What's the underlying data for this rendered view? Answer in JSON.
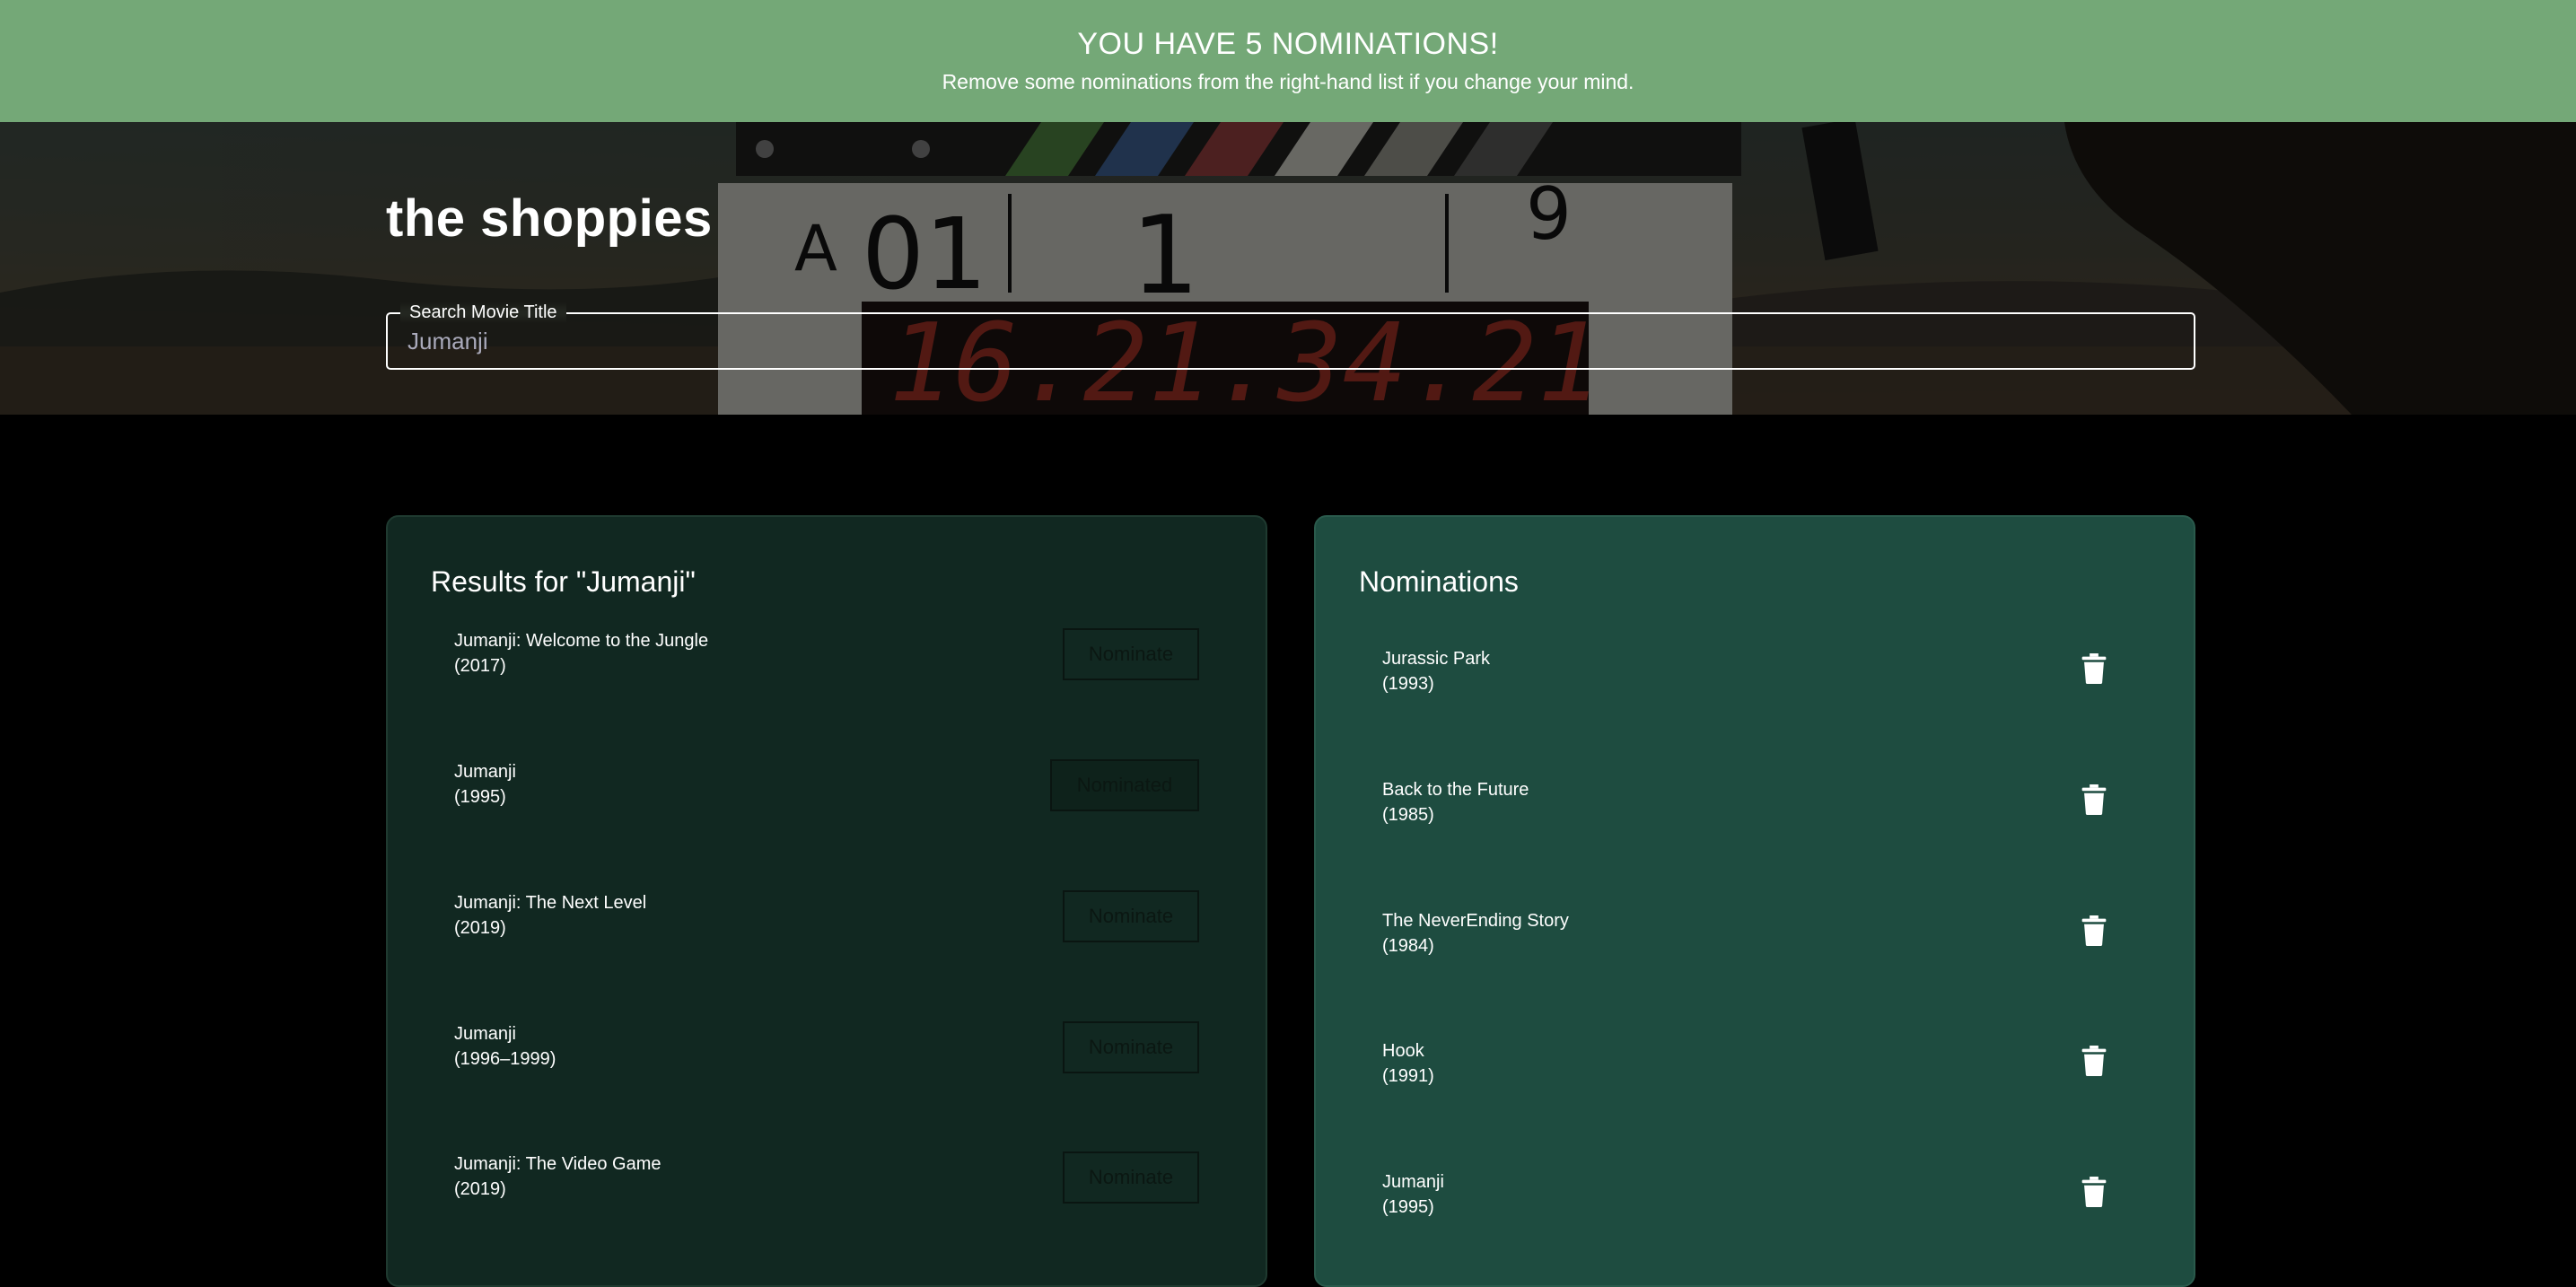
{
  "banner": {
    "title": "YOU HAVE 5 NOMINATIONS!",
    "subtitle": "Remove some nominations from the right-hand list if you change your mind."
  },
  "header": {
    "title": "the shoppies"
  },
  "search": {
    "label": "Search Movie Title",
    "value": "Jumanji"
  },
  "results": {
    "heading": "Results for \"Jumanji\"",
    "items": [
      {
        "title": "Jumanji: Welcome to the Jungle",
        "year": "(2017)",
        "button": "Nominate"
      },
      {
        "title": "Jumanji",
        "year": "(1995)",
        "button": "Nominated"
      },
      {
        "title": "Jumanji: The Next Level",
        "year": "(2019)",
        "button": "Nominate"
      },
      {
        "title": "Jumanji",
        "year": "(1996–1999)",
        "button": "Nominate"
      },
      {
        "title": "Jumanji: The Video Game",
        "year": "(2019)",
        "button": "Nominate"
      }
    ]
  },
  "nominations": {
    "heading": "Nominations",
    "items": [
      {
        "title": "Jurassic Park",
        "year": "(1993)",
        "icon": "trash-icon"
      },
      {
        "title": "Back to the Future",
        "year": "(1985)",
        "icon": "trash-icon"
      },
      {
        "title": "The NeverEnding Story",
        "year": "(1984)",
        "icon": "trash-icon"
      },
      {
        "title": "Hook",
        "year": "(1991)",
        "icon": "trash-icon"
      },
      {
        "title": "Jumanji",
        "year": "(1995)",
        "icon": "trash-icon"
      }
    ]
  },
  "colors": {
    "banner": "#74a877",
    "results_panel": "#112821",
    "nominations_panel": "#1e4c40",
    "background": "#000000"
  }
}
